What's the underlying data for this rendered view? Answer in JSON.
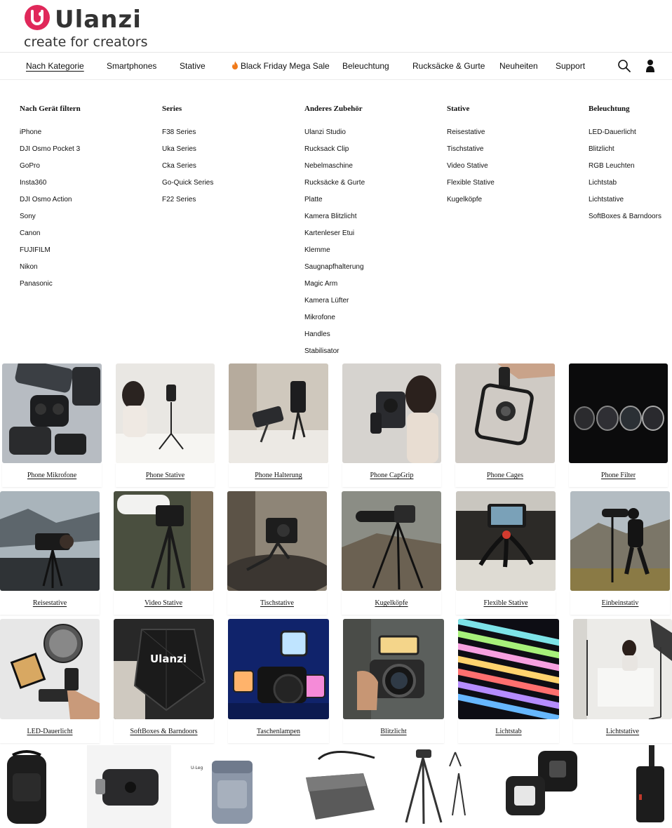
{
  "brand": {
    "name": "Ulanzi",
    "tagline": "create for creators",
    "accent": "#e0285a"
  },
  "nav": {
    "items": [
      "Nach Kategorie",
      "Smartphones",
      "Stative",
      "Black Friday Mega Sale",
      "Beleuchtung",
      "Rucksäcke & Gurte",
      "Neuheiten",
      "Support"
    ],
    "active": "Nach Kategorie",
    "icons": [
      "search-icon",
      "user-icon"
    ]
  },
  "mega_menu": {
    "columns": [
      {
        "title": "Nach Gerät filtern",
        "links": [
          "iPhone",
          "DJI Osmo Pocket 3",
          "GoPro",
          "Insta360",
          "DJI Osmo Action",
          "Sony",
          "Canon",
          "FUJIFILM",
          "Nikon",
          "Panasonic"
        ]
      },
      {
        "title": "Series",
        "links": [
          "F38 Series",
          "Uka Series",
          "Cka Series",
          "Go-Quick Series",
          "F22 Series"
        ]
      },
      {
        "title": "Anderes Zubehör",
        "links": [
          "Ulanzi Studio",
          "Rucksack Clip",
          "Nebelmaschine",
          "Rucksäcke & Gurte",
          "Platte",
          "Kamera Blitzlicht",
          "Kartenleser Etui",
          "Klemme",
          "Saugnapfhalterung",
          "Magic Arm",
          "Kamera Lüfter",
          "Mikrofone",
          "Handles",
          "Stabilisator"
        ]
      },
      {
        "title": "Stative",
        "links": [
          "Reisestative",
          "Tischstative",
          "Video Stative",
          "Flexible Stative",
          "Kugelköpfe"
        ]
      },
      {
        "title": "Beleuchtung",
        "links": [
          "LED-Dauerlicht",
          "Blitzlicht",
          "RGB Leuchten",
          "Lichtstab",
          "Lichtstative",
          "SoftBoxes & Barndoors"
        ]
      }
    ]
  },
  "category_tiles": {
    "row1": [
      "Phone Mikrofone",
      "Phone Stative",
      "Phone Halterung",
      "Phone CapGrip",
      "Phone Cages",
      "Phone Filter"
    ],
    "row2": [
      "Reisestative",
      "Video Stative",
      "Tischstative",
      "Kugelköpfe",
      "Flexible Stative",
      "Einbeinstativ"
    ],
    "row3": [
      "LED-Dauerlicht",
      "SoftBoxes & Barndoors",
      "Taschenlampen",
      "Blitzlicht",
      "Lichtstab",
      "Lichtstative"
    ]
  },
  "tile_image_texts": {
    "softbox_brand": "Ulanzi",
    "backpack_brand": "U-Leg"
  }
}
